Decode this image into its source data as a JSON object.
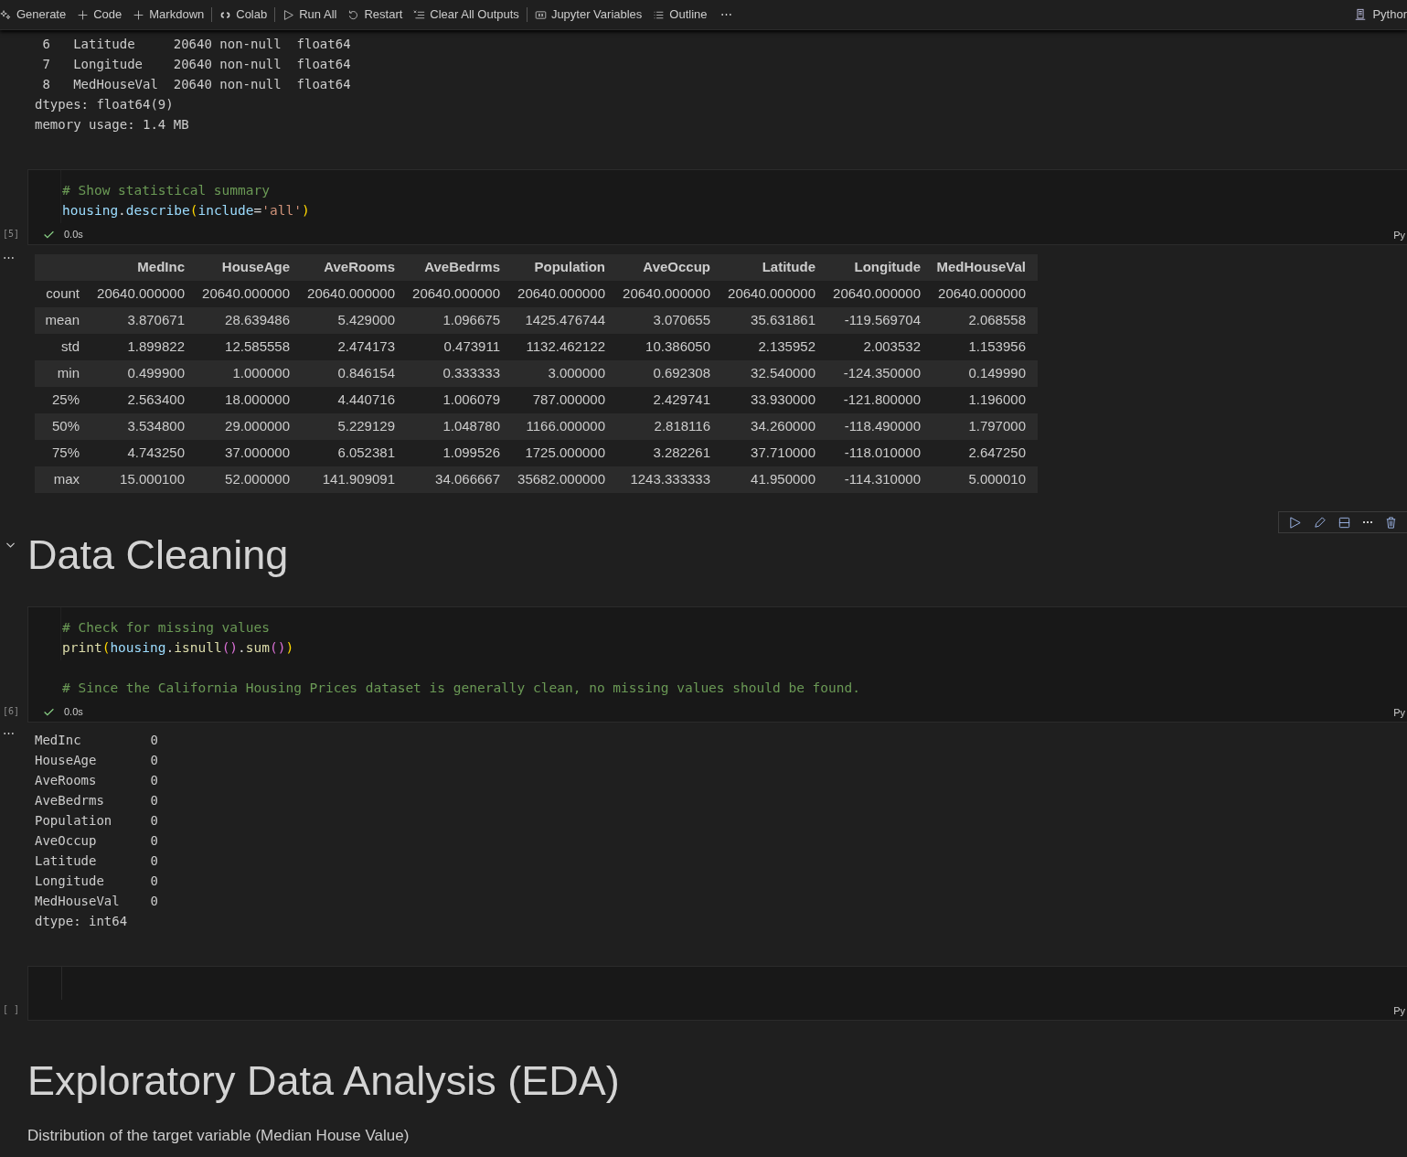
{
  "toolbar": {
    "groups": [
      [
        {
          "kind": "sparkle",
          "label": "Generate"
        },
        {
          "kind": "plus",
          "label": "Code"
        },
        {
          "kind": "plus",
          "label": "Markdown"
        }
      ],
      [
        {
          "kind": "colab",
          "label": "Colab"
        }
      ],
      [
        {
          "kind": "run",
          "label": "Run All"
        },
        {
          "kind": "restart",
          "label": "Restart"
        },
        {
          "kind": "clear",
          "label": "Clear All Outputs"
        }
      ],
      [
        {
          "kind": "variables",
          "label": "Jupyter Variables"
        },
        {
          "kind": "outline",
          "label": "Outline"
        },
        {
          "kind": "more",
          "label": "⋯"
        }
      ]
    ],
    "kernel": "Pythor"
  },
  "cells": [
    {
      "kind": "output_text",
      "lines": [
        " 6   Latitude     20640 non-null  float64",
        " 7   Longitude    20640 non-null  float64",
        " 8   MedHouseVal  20640 non-null  float64",
        "dtypes: float64(9)",
        "memory usage: 1.4 MB"
      ]
    },
    {
      "kind": "code",
      "execution_count": "[5]",
      "status": "0.0s",
      "language": "Py",
      "succeeded": true,
      "blocks": [
        [
          [
            {
              "kind": "comment",
              "text": "# Show statistical summary"
            }
          ],
          [
            {
              "kind": "variable",
              "text": "housing"
            },
            {
              "kind": "plain",
              "text": "."
            },
            {
              "kind": "variable",
              "text": "describe"
            },
            {
              "kind": "bracket",
              "text": "("
            },
            {
              "kind": "variable",
              "text": "include"
            },
            {
              "kind": "plain",
              "text": "="
            },
            {
              "kind": "string",
              "text": "'all'"
            },
            {
              "kind": "bracket",
              "text": ")"
            }
          ]
        ]
      ]
    },
    {
      "kind": "output_table",
      "more": "⋯",
      "columns": [
        "MedInc",
        "HouseAge",
        "AveRooms",
        "AveBedrms",
        "Population",
        "AveOccup",
        "Latitude",
        "Longitude",
        "MedHouseVal"
      ],
      "rows": [
        {
          "label": "count",
          "cells": [
            "20640.000000",
            "20640.000000",
            "20640.000000",
            "20640.000000",
            "20640.000000",
            "20640.000000",
            "20640.000000",
            "20640.000000",
            "20640.000000"
          ]
        },
        {
          "label": "mean",
          "cells": [
            "3.870671",
            "28.639486",
            "5.429000",
            "1.096675",
            "1425.476744",
            "3.070655",
            "35.631861",
            "-119.569704",
            "2.068558"
          ]
        },
        {
          "label": "std",
          "cells": [
            "1.899822",
            "12.585558",
            "2.474173",
            "0.473911",
            "1132.462122",
            "10.386050",
            "2.135952",
            "2.003532",
            "1.153956"
          ]
        },
        {
          "label": "min",
          "cells": [
            "0.499900",
            "1.000000",
            "0.846154",
            "0.333333",
            "3.000000",
            "0.692308",
            "32.540000",
            "-124.350000",
            "0.149990"
          ]
        },
        {
          "label": "25%",
          "cells": [
            "2.563400",
            "18.000000",
            "4.440716",
            "1.006079",
            "787.000000",
            "2.429741",
            "33.930000",
            "-121.800000",
            "1.196000"
          ]
        },
        {
          "label": "50%",
          "cells": [
            "3.534800",
            "29.000000",
            "5.229129",
            "1.048780",
            "1166.000000",
            "2.818116",
            "34.260000",
            "-118.490000",
            "1.797000"
          ]
        },
        {
          "label": "75%",
          "cells": [
            "4.743250",
            "37.000000",
            "6.052381",
            "1.099526",
            "1725.000000",
            "3.282261",
            "37.710000",
            "-118.010000",
            "2.647250"
          ]
        },
        {
          "label": "max",
          "cells": [
            "15.000100",
            "52.000000",
            "141.909091",
            "34.066667",
            "35682.000000",
            "1243.333333",
            "41.950000",
            "-114.310000",
            "5.000010"
          ]
        }
      ]
    },
    {
      "kind": "heading",
      "text": "Data Cleaning",
      "expanded": true,
      "cell_toolbar": [
        {
          "kind": "run"
        },
        {
          "kind": "edit"
        },
        {
          "kind": "split"
        },
        {
          "kind": "more"
        },
        {
          "kind": "delete"
        }
      ]
    },
    {
      "kind": "code",
      "execution_count": "[6]",
      "status": "0.0s",
      "language": "Py",
      "succeeded": true,
      "blocks": [
        [
          [
            {
              "kind": "comment",
              "text": "# Check for missing values"
            }
          ],
          [
            {
              "kind": "function",
              "text": "print"
            },
            {
              "kind": "bracket",
              "text": "("
            },
            {
              "kind": "variable",
              "text": "housing"
            },
            {
              "kind": "plain",
              "text": "."
            },
            {
              "kind": "function",
              "text": "isnull"
            },
            {
              "kind": "bracket2",
              "text": "()"
            },
            {
              "kind": "plain",
              "text": "."
            },
            {
              "kind": "function",
              "text": "sum"
            },
            {
              "kind": "bracket2",
              "text": "()"
            },
            {
              "kind": "bracket",
              "text": ")"
            }
          ]
        ],
        [
          [
            {
              "kind": "comment",
              "text": "# Since the California Housing Prices dataset is generally clean, no missing values should be found."
            }
          ]
        ]
      ]
    },
    {
      "kind": "output_text",
      "more": "⋯",
      "lines": [
        "MedInc         0",
        "HouseAge       0",
        "AveRooms       0",
        "AveBedrms      0",
        "Population     0",
        "AveOccup       0",
        "Latitude       0",
        "Longitude      0",
        "MedHouseVal    0",
        "dtype: int64"
      ]
    },
    {
      "kind": "empty_code",
      "execution_count": "[ ]",
      "language": "Py"
    },
    {
      "kind": "heading",
      "text": "Exploratory Data Analysis (EDA)"
    },
    {
      "kind": "paragraph",
      "text": "Distribution of the target variable (Median House Value)"
    }
  ]
}
